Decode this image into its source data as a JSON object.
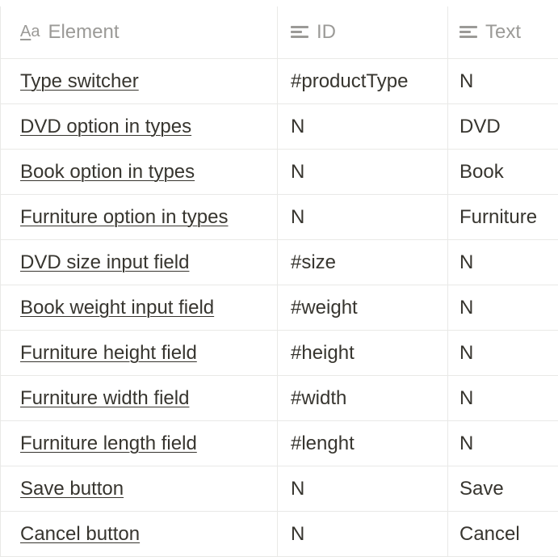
{
  "table": {
    "headers": {
      "element": {
        "icon": "text-title-icon",
        "icon_glyph": "Aa",
        "label": "Element"
      },
      "id": {
        "icon": "text-lines-icon",
        "label": "ID"
      },
      "text": {
        "icon": "text-lines-icon",
        "label": "Text"
      }
    },
    "rows": [
      {
        "element": "Type switcher",
        "id": "#productType",
        "text": "N"
      },
      {
        "element": "DVD option in types",
        "id": "N",
        "text": "DVD"
      },
      {
        "element": "Book option in types",
        "id": "N",
        "text": "Book"
      },
      {
        "element": "Furniture option in types",
        "id": "N",
        "text": "Furniture"
      },
      {
        "element": "DVD size input field",
        "id": "#size",
        "text": "N"
      },
      {
        "element": "Book weight input field",
        "id": "#weight",
        "text": "N"
      },
      {
        "element": "Furniture height field",
        "id": "#height",
        "text": "N"
      },
      {
        "element": "Furniture width field",
        "id": "#width",
        "text": "N"
      },
      {
        "element": "Furniture length field",
        "id": "#lenght",
        "text": "N"
      },
      {
        "element": "Save button",
        "id": "N",
        "text": "Save"
      },
      {
        "element": "Cancel button",
        "id": "N",
        "text": "Cancel"
      }
    ]
  }
}
